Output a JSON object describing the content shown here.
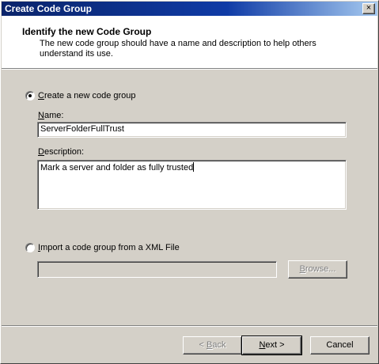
{
  "window": {
    "title": "Create Code Group",
    "close_glyph": "×"
  },
  "header": {
    "title": "Identify the new Code Group",
    "description": "The new code group should have a name and description to help others understand its use."
  },
  "create_option": {
    "label_mnemonic": "C",
    "label_rest": "reate a new code group",
    "selected": true,
    "name_label_mnemonic": "N",
    "name_label_rest": "ame:",
    "name_value": "ServerFolderFullTrust",
    "description_label_mnemonic": "D",
    "description_label_rest": "escription:",
    "description_value": "Mark a server and folder as fully trusted"
  },
  "import_option": {
    "label_mnemonic": "I",
    "label_rest": "mport a code group from a XML File",
    "selected": false,
    "file_value": "",
    "browse_mnemonic": "B",
    "browse_rest": "rowse..."
  },
  "buttons": {
    "back_prefix": "< ",
    "back_mnemonic": "B",
    "back_rest": "ack",
    "next_mnemonic": "N",
    "next_rest": "ext >",
    "cancel_label": "Cancel"
  },
  "colors": {
    "dialog_bg": "#d4d0c8",
    "titlebar": "#0a246a",
    "header_bg": "#ffffff"
  },
  "icons": {
    "close": "close-icon"
  }
}
